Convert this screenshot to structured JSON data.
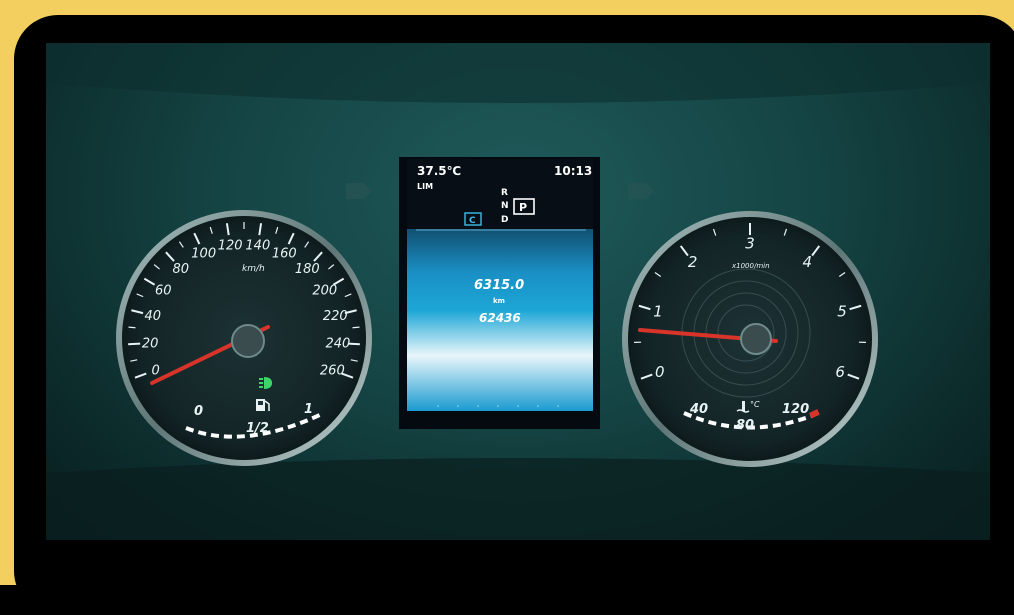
{
  "speedometer": {
    "unit": "km/h",
    "ticks": [
      "0",
      "20",
      "40",
      "60",
      "80",
      "100",
      "120",
      "140",
      "160",
      "180",
      "200",
      "220",
      "240",
      "260"
    ],
    "fuel_labels": [
      "0",
      "1/2",
      "1"
    ]
  },
  "tachometer": {
    "unit": "x1000/min",
    "ticks": [
      "0",
      "1",
      "2",
      "3",
      "4",
      "5",
      "6"
    ],
    "temp_labels": [
      "40",
      "80",
      "120"
    ],
    "temp_unit": "°C",
    "needle_value": 1
  },
  "display": {
    "outside_temp": "37.5℃",
    "time": "10:13",
    "mode": "LIM",
    "gear_r": "R",
    "gear_n": "N",
    "gear_d": "D",
    "gear_selected": "P",
    "program": "C",
    "trip_value": "6315.0",
    "unit": "km",
    "odometer": "62436"
  },
  "colors": {
    "frame": "#f3cf5f",
    "needle": "#d8342a",
    "screen_blue": "#1a9ad0"
  }
}
